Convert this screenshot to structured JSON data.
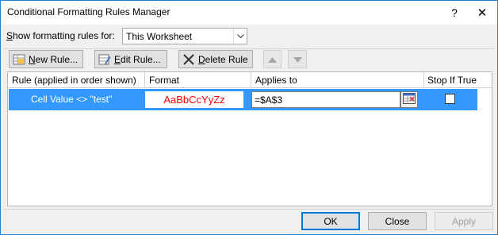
{
  "window": {
    "title": "Conditional Formatting Rules Manager",
    "help_glyph": "?",
    "close_glyph": "✕"
  },
  "scope": {
    "label_prefix": "S",
    "label_rest": "how formatting rules for:",
    "selected": "This Worksheet"
  },
  "toolbar": {
    "new_rule_key": "N",
    "new_rule_rest": "ew Rule...",
    "edit_rule_key": "E",
    "edit_rule_rest": "dit Rule...",
    "delete_rule_key": "D",
    "delete_rule_rest": "elete Rule"
  },
  "grid": {
    "headers": {
      "rule": "Rule (applied in order shown)",
      "format": "Format",
      "applies_to": "Applies to",
      "stop_if_true": "Stop If True"
    },
    "rows": [
      {
        "rule": "Cell Value <> \"test\"",
        "format_preview": "AaBbCcYyZz",
        "applies_to": "=$A$3",
        "stop_if_true": false
      }
    ]
  },
  "footer": {
    "ok": "OK",
    "close": "Close",
    "apply": "Apply"
  },
  "colors": {
    "selection": "#3399ff",
    "format_preview_text": "#ff0000",
    "window_border": "#1883d7"
  },
  "icons": {
    "new_rule": "new-rule-icon",
    "edit_rule": "edit-rule-icon",
    "delete_rule": "delete-x-icon",
    "move_up": "triangle-up-icon",
    "move_down": "triangle-down-icon",
    "range_picker": "range-picker-icon",
    "dropdown": "chevron-down-icon"
  }
}
